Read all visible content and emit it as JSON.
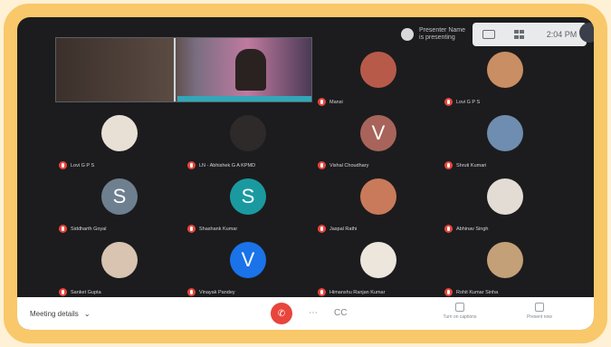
{
  "topbar": {
    "presenter_name": "Presenter Name",
    "presenter_sub": "is presenting",
    "time": "2:04 PM"
  },
  "participants": [
    {
      "name": "Mansi",
      "type": "photo",
      "color": "#b85a4a"
    },
    {
      "name": "Lovi G P S",
      "type": "photo",
      "color": "#c98e63"
    },
    {
      "name": "Lovi G P S",
      "type": "photo",
      "color": "#e8e0d5"
    },
    {
      "name": "LN - Abhishek G A KPMD",
      "type": "photo",
      "color": "#2e2a2a"
    },
    {
      "name": "Vishal Choudhary",
      "type": "letter",
      "letter": "V",
      "color": "#a8645a"
    },
    {
      "name": "Shruti Kumari",
      "type": "photo",
      "color": "#6e8db0"
    },
    {
      "name": "Siddharth Goyal",
      "type": "letter",
      "letter": "S",
      "color": "#6e7f8f"
    },
    {
      "name": "Shashank Kumar",
      "type": "letter",
      "letter": "S",
      "color": "#1a9aa0"
    },
    {
      "name": "Jaspal Rathi",
      "type": "photo",
      "color": "#c97a5a"
    },
    {
      "name": "Abhinav Singh",
      "type": "photo",
      "color": "#e3dcd4"
    },
    {
      "name": "Sanket Gupta",
      "type": "photo",
      "color": "#d8c4b0"
    },
    {
      "name": "Vinayak Pandey",
      "type": "letter",
      "letter": "V",
      "color": "#1a73e8"
    },
    {
      "name": "Himanshu Ranjan Kumar",
      "type": "photo",
      "color": "#ece6dd"
    },
    {
      "name": "Rohit Kumar Sinha",
      "type": "photo",
      "color": "#c4a078"
    }
  ],
  "bottombar": {
    "meeting_details": "Meeting details",
    "chevron": "⌄",
    "more": "⋯",
    "captions": "CC",
    "present_label": "Turn on captions",
    "present_now": "Present now",
    "leave_icon": "✆"
  }
}
